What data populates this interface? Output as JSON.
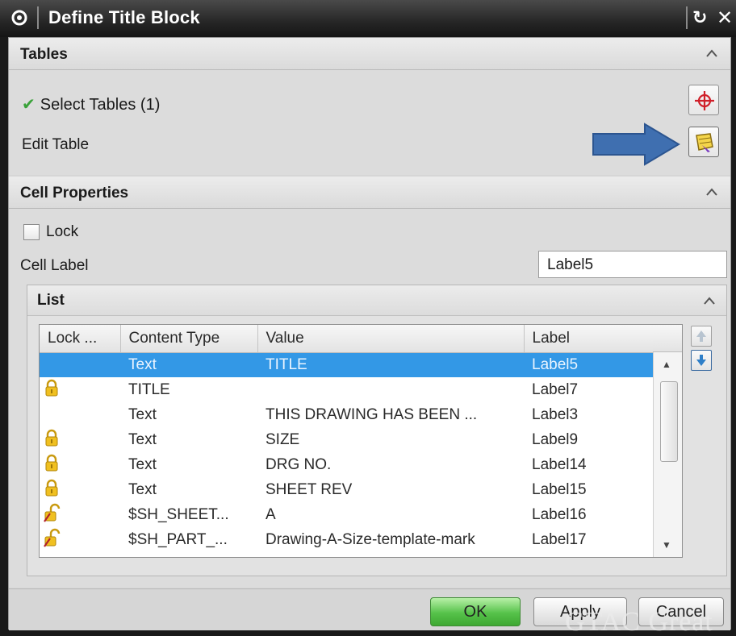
{
  "window": {
    "title": "Define Title Block"
  },
  "tables_section": {
    "header": "Tables",
    "select_tables_label": "Select Tables (1)",
    "edit_table_label": "Edit Table"
  },
  "cell_properties": {
    "header": "Cell Properties",
    "lock_label": "Lock",
    "lock_checked": false,
    "cell_label_label": "Cell Label",
    "cell_label_value": "Label5"
  },
  "list": {
    "header": "List",
    "columns": [
      "Lock ...",
      "Content Type",
      "Value",
      "Label"
    ],
    "rows": [
      {
        "lock": "none",
        "content_type": "Text",
        "value": "TITLE",
        "label": "Label5",
        "selected": true
      },
      {
        "lock": "locked",
        "content_type": "TITLE",
        "value": "",
        "label": "Label7",
        "selected": false
      },
      {
        "lock": "none",
        "content_type": "Text",
        "value": "THIS DRAWING HAS BEEN ...",
        "label": "Label3",
        "selected": false
      },
      {
        "lock": "locked",
        "content_type": "Text",
        "value": "SIZE",
        "label": "Label9",
        "selected": false
      },
      {
        "lock": "locked",
        "content_type": "Text",
        "value": "DRG NO.",
        "label": "Label14",
        "selected": false
      },
      {
        "lock": "locked",
        "content_type": "Text",
        "value": "SHEET REV",
        "label": "Label15",
        "selected": false
      },
      {
        "lock": "unlocked",
        "content_type": "$SH_SHEET...",
        "value": "A",
        "label": "Label16",
        "selected": false
      },
      {
        "lock": "unlocked",
        "content_type": "$SH_PART_...",
        "value": "Drawing-A-Size-template-mark",
        "label": "Label17",
        "selected": false
      }
    ]
  },
  "footer": {
    "ok_label": "OK",
    "apply_label": "Apply",
    "cancel_label": "Cancel"
  },
  "watermark": "GTAC Great",
  "colors": {
    "selection": "#3398e6",
    "ok_green": "#56c24a",
    "arrow_blue": "#3f6fb0",
    "check_green": "#3aa23a",
    "lock_yellow": "#f0c020"
  },
  "icons": {
    "select_tables": "crosshair-icon",
    "edit_table": "edit-table-icon",
    "move_up": "move-up-icon",
    "move_down": "move-down-icon"
  }
}
